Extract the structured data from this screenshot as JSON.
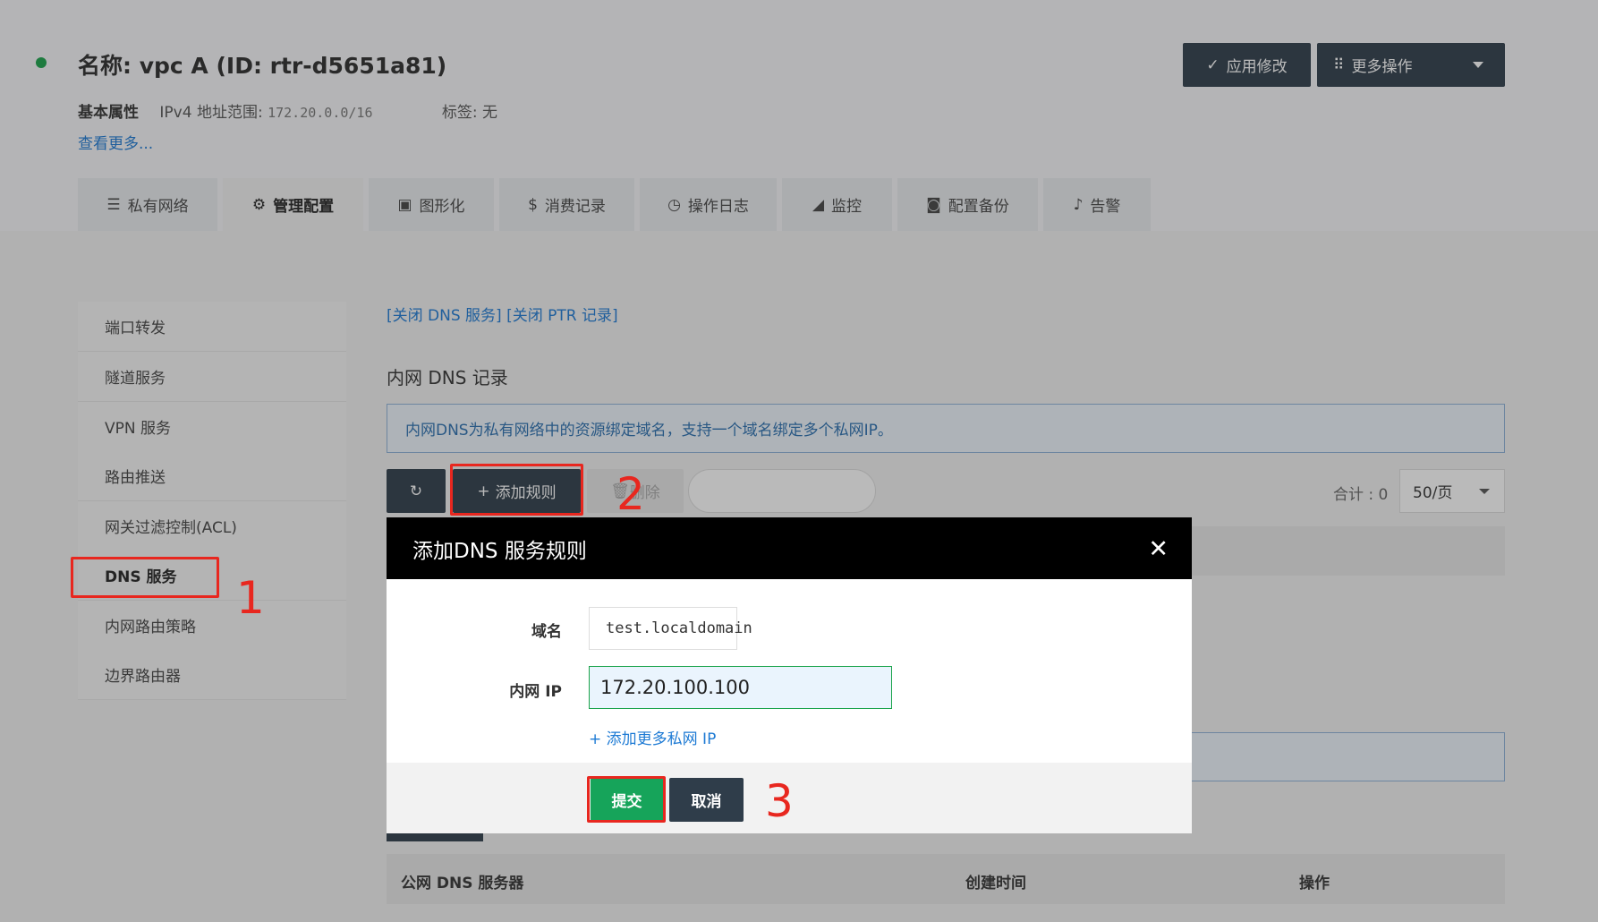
{
  "header": {
    "title": "名称: vpc A (ID: rtr-d5651a81)",
    "basic_label": "基本属性",
    "ipv4_label": "IPv4 地址范围:",
    "ipv4_value": "172.20.0.0/16",
    "tags_label": "标签:",
    "tags_value": "无",
    "view_more": "查看更多...",
    "apply_label": "应用修改",
    "more_actions_label": "更多操作"
  },
  "tabs": [
    {
      "label": "私有网络"
    },
    {
      "label": "管理配置"
    },
    {
      "label": "图形化"
    },
    {
      "label": "消费记录"
    },
    {
      "label": "操作日志"
    },
    {
      "label": "监控"
    },
    {
      "label": "配置备份"
    },
    {
      "label": "告警"
    }
  ],
  "sidebar": {
    "items": [
      {
        "label": "端口转发"
      },
      {
        "label": "隧道服务"
      },
      {
        "label": "VPN 服务"
      },
      {
        "label": "路由推送"
      },
      {
        "label": "网关过滤控制(ACL)"
      },
      {
        "label": "DNS 服务"
      },
      {
        "label": "内网路由策略"
      },
      {
        "label": "边界路由器"
      }
    ]
  },
  "main": {
    "links": {
      "close_dns": "[关闭 DNS 服务]",
      "close_ptr": "[关闭 PTR 记录]"
    },
    "section_title": "内网 DNS 记录",
    "info_text": "内网DNS为私有网络中的资源绑定域名，支持一个域名绑定多个私网IP。",
    "add_rule_label": "添加规则",
    "delete_label": "删除",
    "total_label": "合计 : 0",
    "page_size": "50/页",
    "table2": {
      "col1": "公网 DNS 服务器",
      "col2": "创建时间",
      "col3": "操作"
    }
  },
  "modal": {
    "title": "添加DNS 服务规则",
    "domain_label": "域名",
    "domain_value": "test.localdomain",
    "ip_label": "内网 IP",
    "ip_value": "172.20.100.100",
    "add_more_ip": "添加更多私网 IP",
    "submit_label": "提交",
    "cancel_label": "取消"
  },
  "annotations": {
    "n1": "1",
    "n2": "2",
    "n3": "3"
  },
  "colors": {
    "accent_dark": "#2f3d4a",
    "success": "#16a45a",
    "link": "#1d7ad4",
    "annotation": "#e8271f"
  }
}
